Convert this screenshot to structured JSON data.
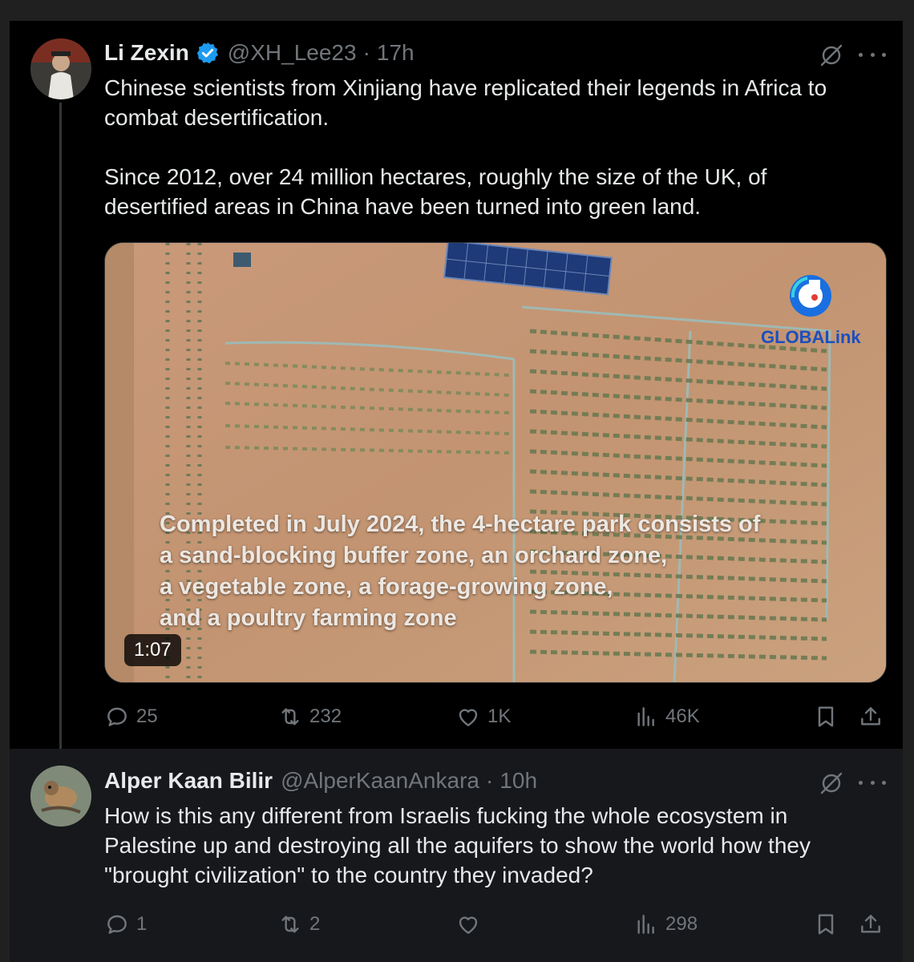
{
  "tweets": [
    {
      "author": {
        "name": "Li Zexin",
        "handle": "@XH_Lee23",
        "verified": true
      },
      "time": "17h",
      "text": "Chinese scientists from Xinjiang have replicated their legends in Africa to combat desertification.\n\nSince 2012, over 24 million hectares, roughly the size of the UK, of desertified areas in China have been turned into green land.",
      "media": {
        "type": "video",
        "duration": "1:07",
        "brand": "GLOBALink",
        "caption_lines": [
          "Completed in July 2024, the 4-hectare park consists of",
          "a sand-blocking buffer zone, an orchard zone,",
          "a vegetable zone, a forage-growing zone,",
          "and a poultry farming zone"
        ]
      },
      "stats": {
        "replies": "25",
        "reposts": "232",
        "likes": "1K",
        "views": "46K"
      }
    },
    {
      "author": {
        "name": "Alper Kaan Bilir",
        "handle": "@AlperKaanAnkara",
        "verified": false
      },
      "time": "10h",
      "text": "How is this any different from Israelis fucking the whole ecosystem in Palestine up and destroying all the aquifers to show the world how they \"brought civilization\" to the country they invaded?",
      "stats": {
        "replies": "1",
        "reposts": "2",
        "likes": "",
        "views": "298"
      }
    }
  ],
  "icons": {
    "verified": "verified-badge-icon",
    "grok": "grok-icon",
    "more": "more-icon",
    "reply": "reply-icon",
    "repost": "repost-icon",
    "like": "like-icon",
    "views": "views-icon",
    "bookmark": "bookmark-icon",
    "share": "share-icon"
  },
  "colors": {
    "background": "#000000",
    "text": "#e7e9ea",
    "muted": "#71767b",
    "verified": "#1d9bf0"
  }
}
